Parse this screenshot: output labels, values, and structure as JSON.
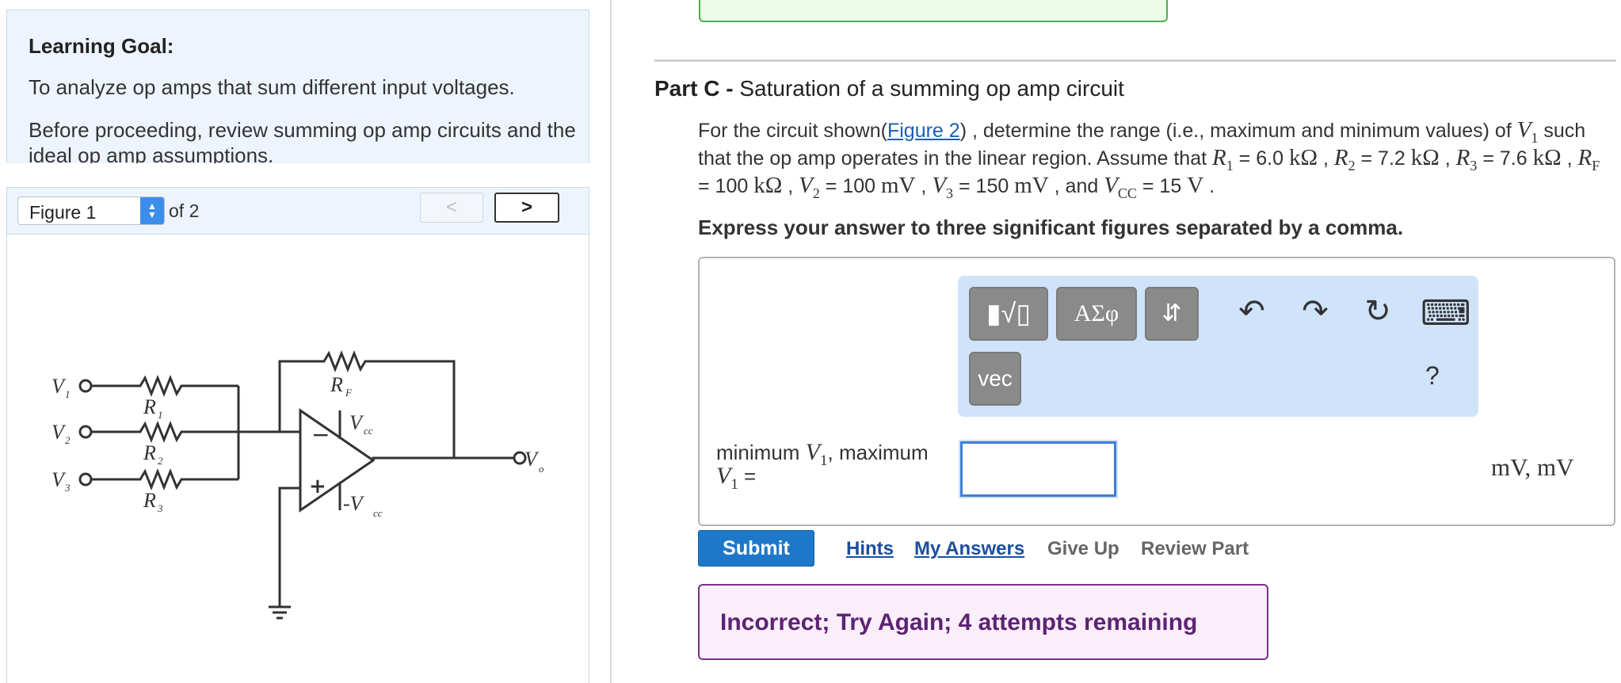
{
  "learning_goal": {
    "title": "Learning Goal:",
    "paragraph1": "To analyze op amps that sum different input voltages.",
    "paragraph2": "Before proceeding, review summing op amp circuits and the ideal op amp assumptions."
  },
  "figure_nav": {
    "selected": "Figure 1",
    "of_label": "of 2",
    "prev_glyph": "<",
    "next_glyph": ">"
  },
  "circuit_labels": {
    "v1": "V",
    "v1_sub": "1",
    "v2": "V",
    "v2_sub": "2",
    "v3": "V",
    "v3_sub": "3",
    "r1": "R",
    "r1_sub": "1",
    "r2": "R",
    "r2_sub": "2",
    "r3": "R",
    "r3_sub": "3",
    "rf": "R",
    "rf_sub": "F",
    "vcc": "V",
    "vcc_sub": "cc",
    "neg_vcc": "-V",
    "neg_vcc_sub": "cc",
    "vo": "V",
    "vo_sub": "o",
    "minus": "−",
    "plus": "+"
  },
  "part": {
    "label": "Part C - ",
    "title": "Saturation of a summing op amp circuit"
  },
  "problem": {
    "t1": "For the circuit shown(",
    "figure_link": "Figure 2",
    "t2": ") , determine the range (i.e., maximum and minimum values) of ",
    "v1": "V",
    "v1_sub": "1",
    "t3": "such that the op amp operates in the linear region. Assume that ",
    "r1": "R",
    "r1_sub": "1",
    "r1_val": " = 6.0 ",
    "kohm": "kΩ",
    "sep": " , ",
    "r2": "R",
    "r2_sub": "2",
    "r2_val": " = 7.2 ",
    "r3": "R",
    "r3_sub": "3",
    "r3_val": " = 7.6 ",
    "rf": "R",
    "rf_sub": "F",
    "rf_val": " = 100 ",
    "v2": "V",
    "v2_sub": "2",
    "v2_val": " = 100 ",
    "mv": "mV",
    "v3": "V",
    "v3_sub": "3",
    "v3_val": " = 150 ",
    "and": " , and ",
    "vcc": "V",
    "vcc_sub": "CC",
    "vcc_val": " = 15 ",
    "volt": "V",
    "end": " ."
  },
  "instruction": "Express your answer to three significant figures separated by a comma.",
  "toolbar": {
    "templates_glyph": "▮√▯",
    "greek": "ΑΣφ",
    "arrows": "⇵",
    "vec": "vec",
    "undo_glyph": "↶",
    "redo_glyph": "↷",
    "reset_glyph": "↻",
    "keyboard_glyph": "⌨",
    "help": "?"
  },
  "answer": {
    "label_t1": "minimum ",
    "v": "V",
    "sub": "1",
    "label_t2": ", maximum",
    "label_t3": " =",
    "value": "",
    "units": "mV, mV"
  },
  "actions": {
    "submit": "Submit",
    "hints": "Hints",
    "my_answers": "My Answers",
    "give_up": "Give Up",
    "review_part": "Review Part"
  },
  "feedback": "Incorrect; Try Again; 4 attempts remaining",
  "colors": {
    "submit": "#1e78c9",
    "feedback_border": "#7a2f8c",
    "toolbar_bg": "#cfe4fb",
    "link_blue": "#1a4fa0"
  }
}
